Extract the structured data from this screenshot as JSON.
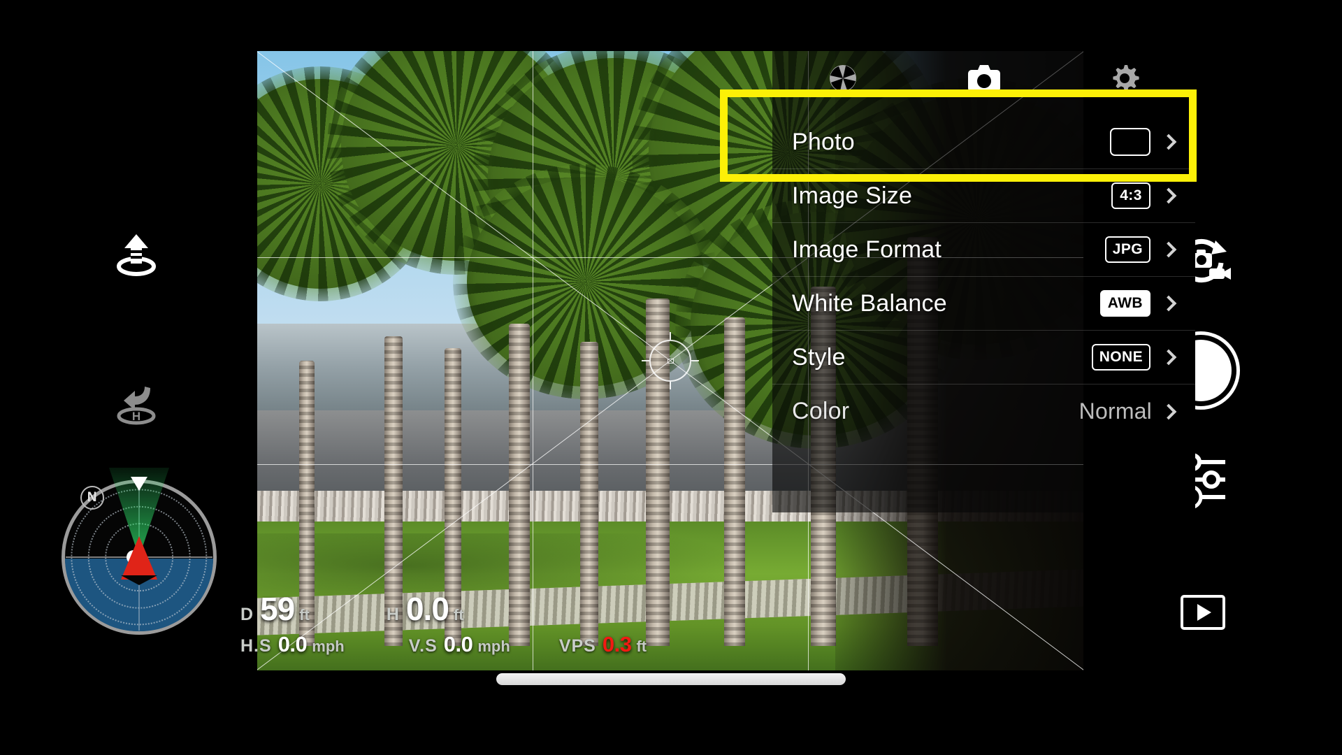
{
  "app": {
    "name": "drone-camera-controller"
  },
  "camera_tabs": [
    {
      "id": "exposure",
      "icon": "aperture-icon",
      "active": false
    },
    {
      "id": "photo",
      "icon": "camera-icon",
      "active": true
    },
    {
      "id": "settings",
      "icon": "gear-icon",
      "active": false
    }
  ],
  "active_indicator_color": "#2196f3",
  "settings_menu": {
    "rows": [
      {
        "label": "Photo",
        "value": "",
        "value_style": "empty-box",
        "chevron": "›"
      },
      {
        "label": "Image Size",
        "value": "4:3",
        "value_style": "outline-box",
        "chevron": "›"
      },
      {
        "label": "Image Format",
        "value": "JPG",
        "value_style": "outline-box",
        "chevron": "›"
      },
      {
        "label": "White Balance",
        "value": "AWB",
        "value_style": "filled-box",
        "chevron": "›"
      },
      {
        "label": "Style",
        "value": "NONE",
        "value_style": "outline-box",
        "chevron": "›"
      },
      {
        "label": "Color",
        "value": "Normal",
        "value_style": "plain-text",
        "chevron": "›"
      }
    ]
  },
  "highlight": {
    "target_row": "Photo",
    "color": "#fcf007"
  },
  "telemetry": {
    "distance": {
      "label": "D",
      "value": "59",
      "unit": "ft",
      "color": "#ffffff"
    },
    "height": {
      "label": "H",
      "value": "0.0",
      "unit": "ft",
      "color": "#ffffff"
    },
    "horizontal_speed": {
      "label": "H.S",
      "value": "0.0",
      "unit": "mph",
      "color": "#ffffff"
    },
    "vertical_speed": {
      "label": "V.S",
      "value": "0.0",
      "unit": "mph",
      "color": "#ffffff"
    },
    "vps": {
      "label": "VPS",
      "value": "0.3",
      "unit": "ft",
      "color": "#f21a12"
    }
  },
  "radar": {
    "north_label": "N",
    "heading_marker": "triangle-up",
    "aircraft_marker": "red-arrow",
    "fov_cone_color": "#2edc68",
    "bottom_hemisphere_color": "#1d5580"
  },
  "left_controls": [
    {
      "id": "takeoff",
      "icon": "takeoff-icon",
      "state": "active"
    },
    {
      "id": "return-to-home",
      "icon": "return-to-home-icon",
      "state": "disabled"
    }
  ],
  "right_controls": [
    {
      "id": "mode-switch",
      "icon": "photo-video-switch-icon"
    },
    {
      "id": "shutter",
      "icon": "shutter-button-icon"
    },
    {
      "id": "manual",
      "icon": "manual-sliders-icon"
    },
    {
      "id": "playback",
      "icon": "playback-icon"
    }
  ]
}
